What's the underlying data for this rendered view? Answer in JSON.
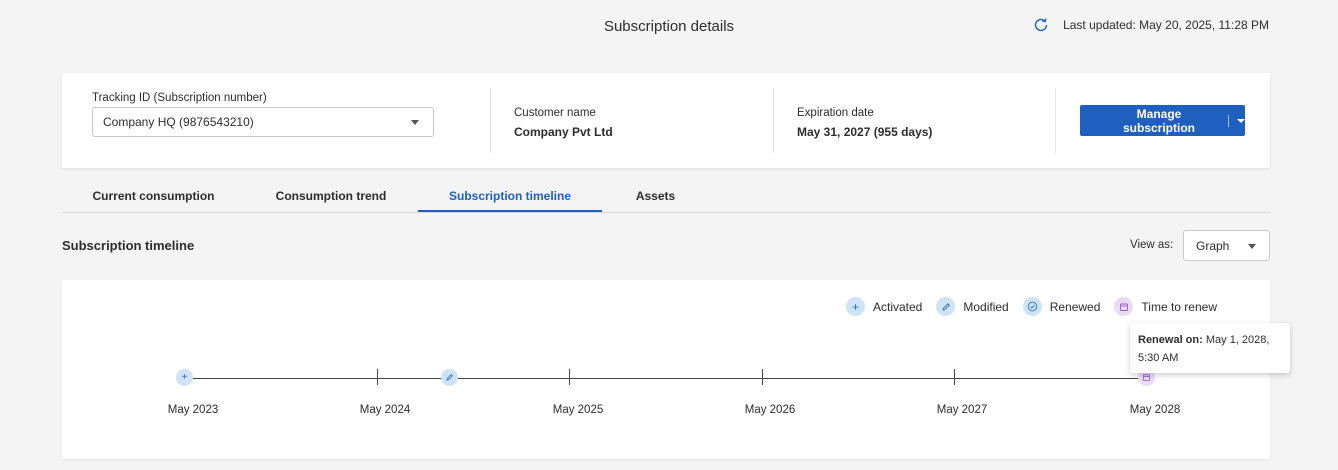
{
  "header": {
    "title": "Subscription details",
    "last_updated": "Last updated: May 20, 2025, 11:28 PM"
  },
  "info": {
    "tracking_label": "Tracking ID (Subscription number)",
    "tracking_value": "Company HQ (9876543210)",
    "customer_label": "Customer name",
    "customer_value": "Company Pvt Ltd",
    "expiration_label": "Expiration date",
    "expiration_value": "May 31, 2027 (955 days)",
    "manage_button": "Manage subscription"
  },
  "tabs": [
    {
      "label": "Current consumption",
      "active": false
    },
    {
      "label": "Consumption trend",
      "active": false
    },
    {
      "label": "Subscription timeline",
      "active": true
    },
    {
      "label": "Assets",
      "active": false
    }
  ],
  "section": {
    "title": "Subscription timeline",
    "view_as_label": "View as:",
    "view_as_value": "Graph"
  },
  "legend": [
    {
      "label": "Activated",
      "icon": "plus-icon"
    },
    {
      "label": "Modified",
      "icon": "pencil-icon"
    },
    {
      "label": "Renewed",
      "icon": "check-circle-icon"
    },
    {
      "label": "Time to renew",
      "icon": "calendar-icon"
    }
  ],
  "timeline": {
    "ticks": [
      "May 2023",
      "May 2024",
      "May 2025",
      "May 2026",
      "May 2027",
      "May 2028"
    ],
    "tooltip_label": "Renewal on:",
    "tooltip_value": "May 1, 2028, 5:30 AM"
  },
  "colors": {
    "accent": "#1f5fbf",
    "event_blue_bg": "#cfe3f7",
    "event_purple_bg": "#eadbf5"
  }
}
